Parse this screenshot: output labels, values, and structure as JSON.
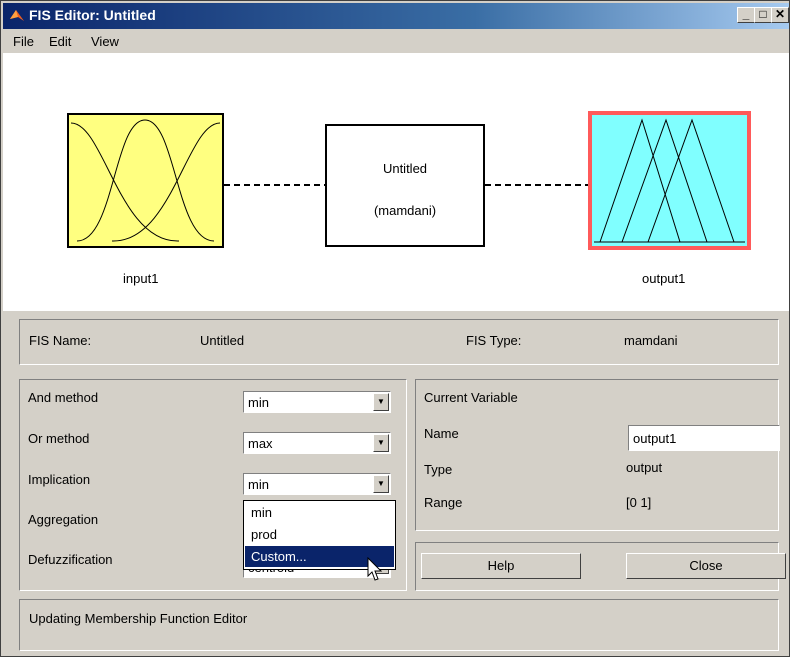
{
  "window": {
    "title": "FIS Editor: Untitled",
    "controls": {
      "minimize": "_",
      "maximize": "□",
      "close": "✕"
    }
  },
  "menu": [
    "File",
    "Edit",
    "View"
  ],
  "diagram": {
    "input_label": "input1",
    "output_label": "output1",
    "system_name": "Untitled",
    "system_type": "(mamdani)",
    "colors": {
      "input_fill": "#ffff80",
      "output_fill": "#80ffff",
      "output_border": "#ff5a5a"
    }
  },
  "fis_info": {
    "name_label": "FIS Name:",
    "name_value": "Untitled",
    "type_label": "FIS Type:",
    "type_value": "mamdani"
  },
  "methods": {
    "and_label": "And method",
    "and_value": "min",
    "or_label": "Or method",
    "or_value": "max",
    "implication_label": "Implication",
    "implication_value": "min",
    "aggregation_label": "Aggregation",
    "defuzz_label": "Defuzzification",
    "defuzz_value": "centroid"
  },
  "implication_dropdown": {
    "options": [
      "min",
      "prod",
      "Custom..."
    ],
    "highlighted_index": 2
  },
  "current_variable": {
    "heading": "Current Variable",
    "name_label": "Name",
    "name_value": "output1",
    "type_label": "Type",
    "type_value": "output",
    "range_label": "Range",
    "range_value": "[0 1]"
  },
  "buttons": {
    "help": "Help",
    "close": "Close"
  },
  "status": "Updating Membership Function Editor"
}
